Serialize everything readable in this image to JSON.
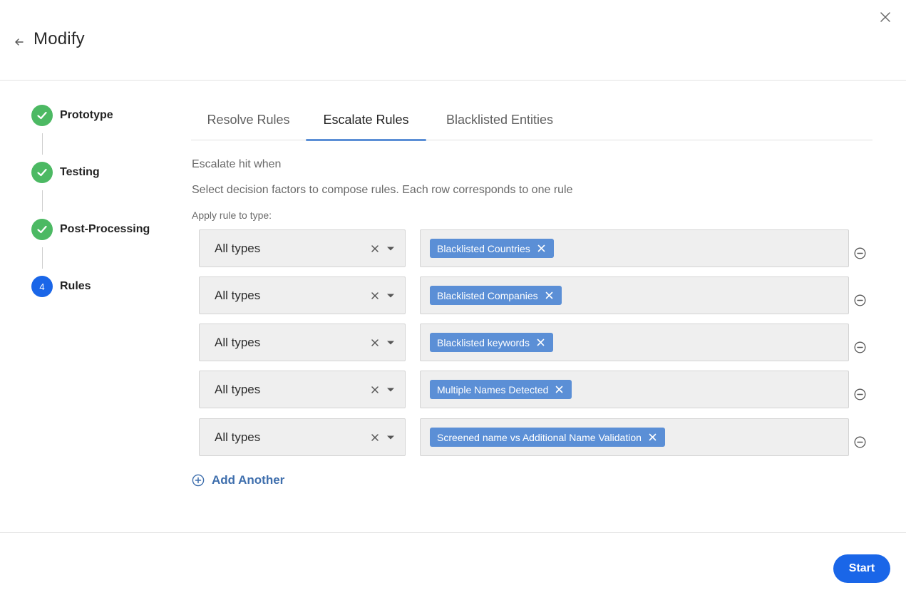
{
  "header": {
    "title": "Modify",
    "back_icon": "arrow-left-icon",
    "close_icon": "close-icon"
  },
  "stepper": {
    "steps": [
      {
        "label": "Prototype",
        "state": "done"
      },
      {
        "label": "Testing",
        "state": "done"
      },
      {
        "label": "Post-Processing",
        "state": "done"
      },
      {
        "label": "Rules",
        "state": "current",
        "number": "4"
      }
    ],
    "colors": {
      "done": "#4cb963",
      "current": "#1a66e8"
    }
  },
  "tabs": [
    {
      "label": "Resolve Rules",
      "active": false
    },
    {
      "label": "Escalate Rules",
      "active": true
    },
    {
      "label": "Blacklisted Entities",
      "active": false
    }
  ],
  "content": {
    "escalate_text": "Escalate hit when",
    "select_text": "Select decision factors to compose rules. Each row corresponds to one rule",
    "apply_label": "Apply rule to type:"
  },
  "rules": [
    {
      "type": "All types",
      "factor": "Blacklisted Countries"
    },
    {
      "type": "All types",
      "factor": "Blacklisted Companies"
    },
    {
      "type": "All types",
      "factor": "Blacklisted keywords"
    },
    {
      "type": "All types",
      "factor": "Multiple Names Detected"
    },
    {
      "type": "All types",
      "factor": "Screened name vs Additional Name Validation"
    }
  ],
  "add_another": {
    "label": "Add Another",
    "icon": "plus-circle-icon"
  },
  "footer": {
    "start_label": "Start"
  },
  "theme": {
    "accent": "#1a66e8",
    "chip": "#5b8fd6",
    "link": "#3f6fad"
  }
}
